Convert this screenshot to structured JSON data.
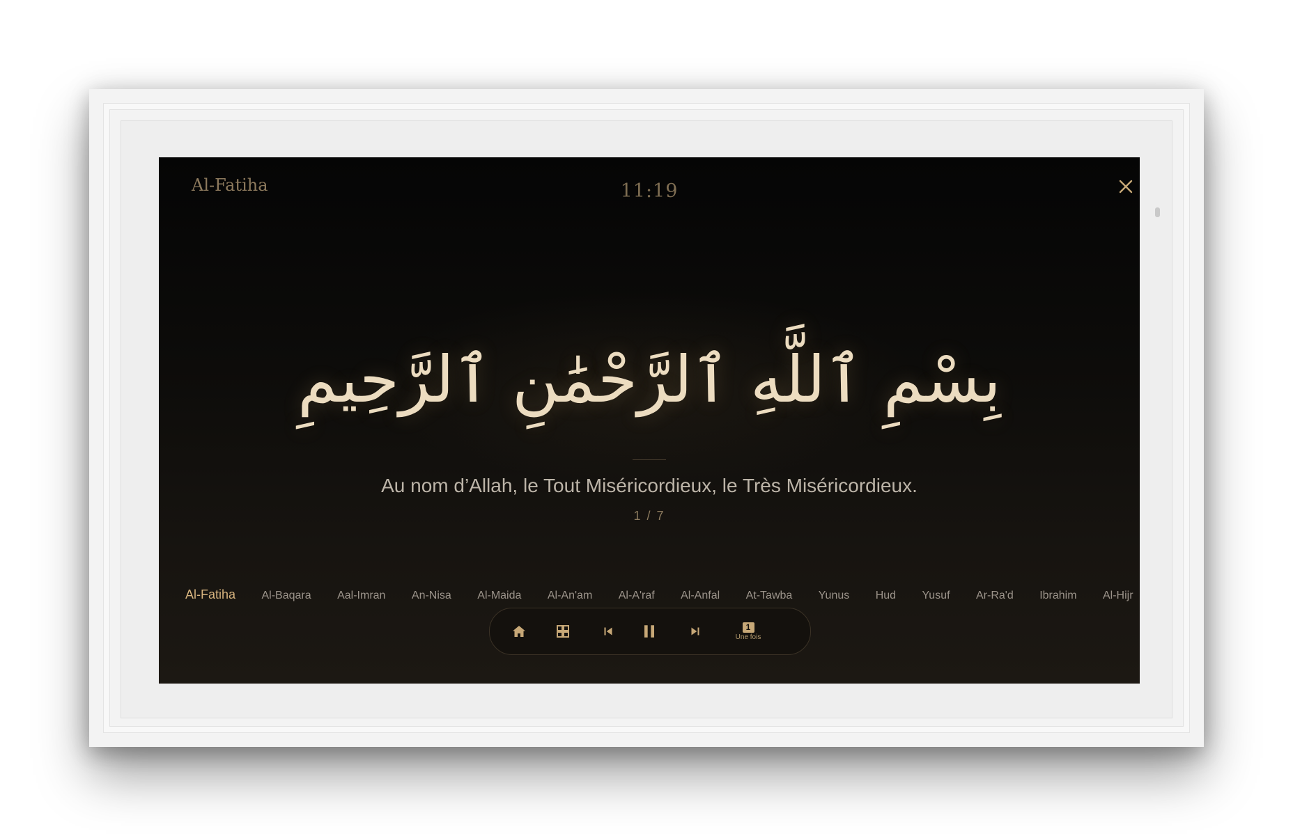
{
  "header": {
    "surah_title": "Al-Fatiha",
    "clock": "11:19"
  },
  "verse": {
    "arabic": "بِسْمِ ٱللَّهِ ٱلرَّحْمَٰنِ ٱلرَّحِيمِ",
    "translation": "Au nom d’Allah, le Tout Miséricordieux, le Très Miséricordieux.",
    "counter": "1 / 7"
  },
  "surahs": {
    "items": [
      {
        "label": "Al-Fatiha"
      },
      {
        "label": "Al-Baqara"
      },
      {
        "label": "Aal-Imran"
      },
      {
        "label": "An-Nisa"
      },
      {
        "label": "Al-Maida"
      },
      {
        "label": "Al-An'am"
      },
      {
        "label": "Al-A'raf"
      },
      {
        "label": "Al-Anfal"
      },
      {
        "label": "At-Tawba"
      },
      {
        "label": "Yunus"
      },
      {
        "label": "Hud"
      },
      {
        "label": "Yusuf"
      },
      {
        "label": "Ar-Ra'd"
      },
      {
        "label": "Ibrahim"
      },
      {
        "label": "Al-Hijr"
      }
    ],
    "active": "Al-Fatiha"
  },
  "controls": {
    "home_icon": "home-icon",
    "grid_icon": "grid-icon",
    "previous_icon": "skip-previous-icon",
    "pause_icon": "pause-icon",
    "next_icon": "skip-next-icon",
    "repeat_count": "1",
    "repeat_label": "Une fois"
  },
  "colors": {
    "accent": "#d6b37e",
    "icon": "#c7a877",
    "background": "#0d0c0a"
  }
}
